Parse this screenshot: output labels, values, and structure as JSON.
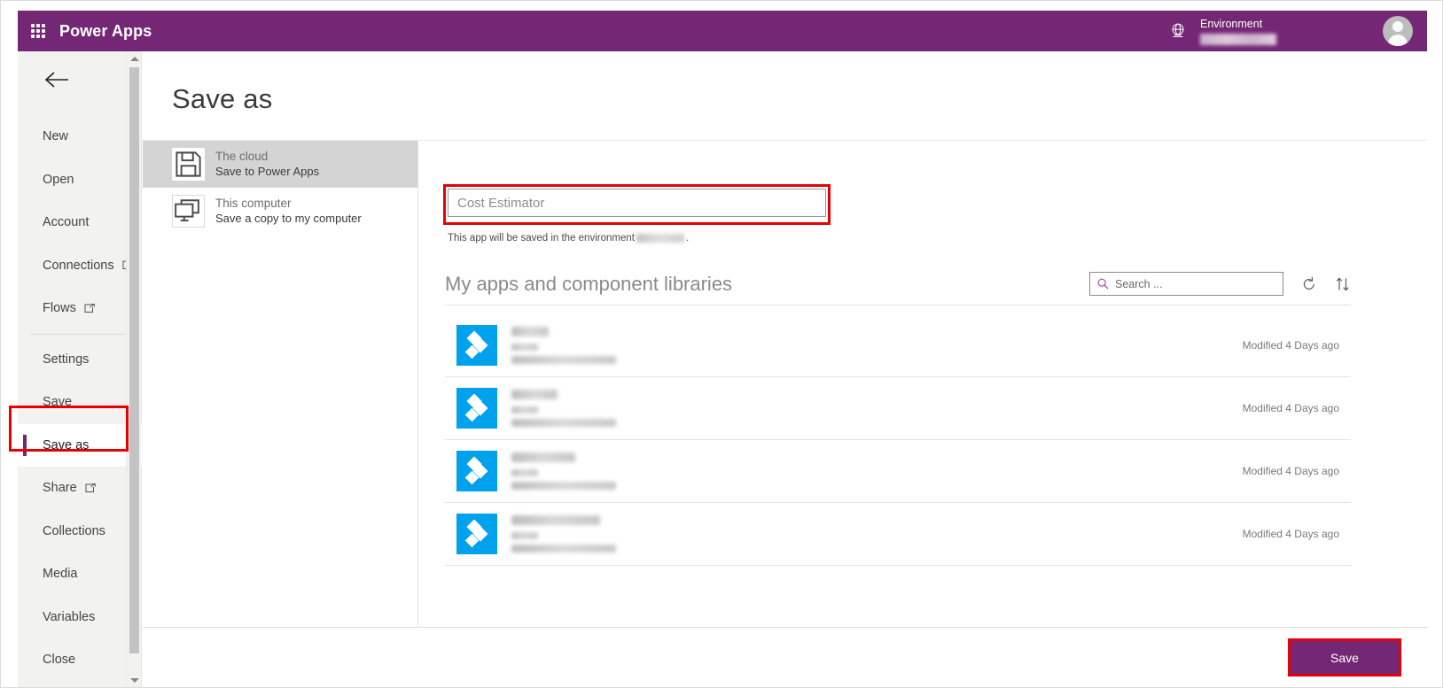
{
  "topbar": {
    "waffle_label": "App launcher",
    "brand": "Power Apps",
    "environment_label": "Environment",
    "environment_value": ""
  },
  "sidebar": {
    "back_label": "Back",
    "items": [
      {
        "label": "New",
        "external": false,
        "selected": false
      },
      {
        "label": "Open",
        "external": false,
        "selected": false
      },
      {
        "label": "Account",
        "external": false,
        "selected": false
      },
      {
        "label": "Connections",
        "external": true,
        "selected": false
      },
      {
        "label": "Flows",
        "external": true,
        "selected": false
      },
      {
        "label": "Settings",
        "external": false,
        "selected": false
      },
      {
        "label": "Save",
        "external": false,
        "selected": false
      },
      {
        "label": "Save as",
        "external": false,
        "selected": true
      },
      {
        "label": "Share",
        "external": true,
        "selected": false
      },
      {
        "label": "Collections",
        "external": false,
        "selected": false
      },
      {
        "label": "Media",
        "external": false,
        "selected": false
      },
      {
        "label": "Variables",
        "external": false,
        "selected": false
      },
      {
        "label": "Close",
        "external": false,
        "selected": false
      }
    ]
  },
  "main": {
    "page_title": "Save as",
    "destinations": [
      {
        "title": "The cloud",
        "subtitle": "Save to Power Apps",
        "icon": "floppy-disk-icon",
        "active": true
      },
      {
        "title": "This computer",
        "subtitle": "Save a copy to my computer",
        "icon": "computer-icon",
        "active": false
      }
    ],
    "name_field": {
      "value": "Cost Estimator",
      "placeholder": "Cost Estimator"
    },
    "help_text_before": "This app will be saved in the environment",
    "help_text_after": ".",
    "list_title": "My apps and component libraries",
    "search": {
      "placeholder": "Search ..."
    },
    "refresh_icon": "refresh-icon",
    "sort_icon": "sort-icon",
    "apps": [
      {
        "name": "",
        "modified": "Modified 4 Days ago",
        "name_width": 42
      },
      {
        "name": "",
        "modified": "Modified 4 Days ago",
        "name_width": 52
      },
      {
        "name": "",
        "modified": "Modified 4 Days ago",
        "name_width": 72
      },
      {
        "name": "",
        "modified": "Modified 4 Days ago",
        "name_width": 100
      }
    ]
  },
  "footer": {
    "save_label": "Save"
  },
  "colors": {
    "brand_purple": "#742774",
    "tile_blue": "#00a2ed",
    "annotation_red": "#e60000",
    "sidebar_bg": "#f2f2f1"
  }
}
